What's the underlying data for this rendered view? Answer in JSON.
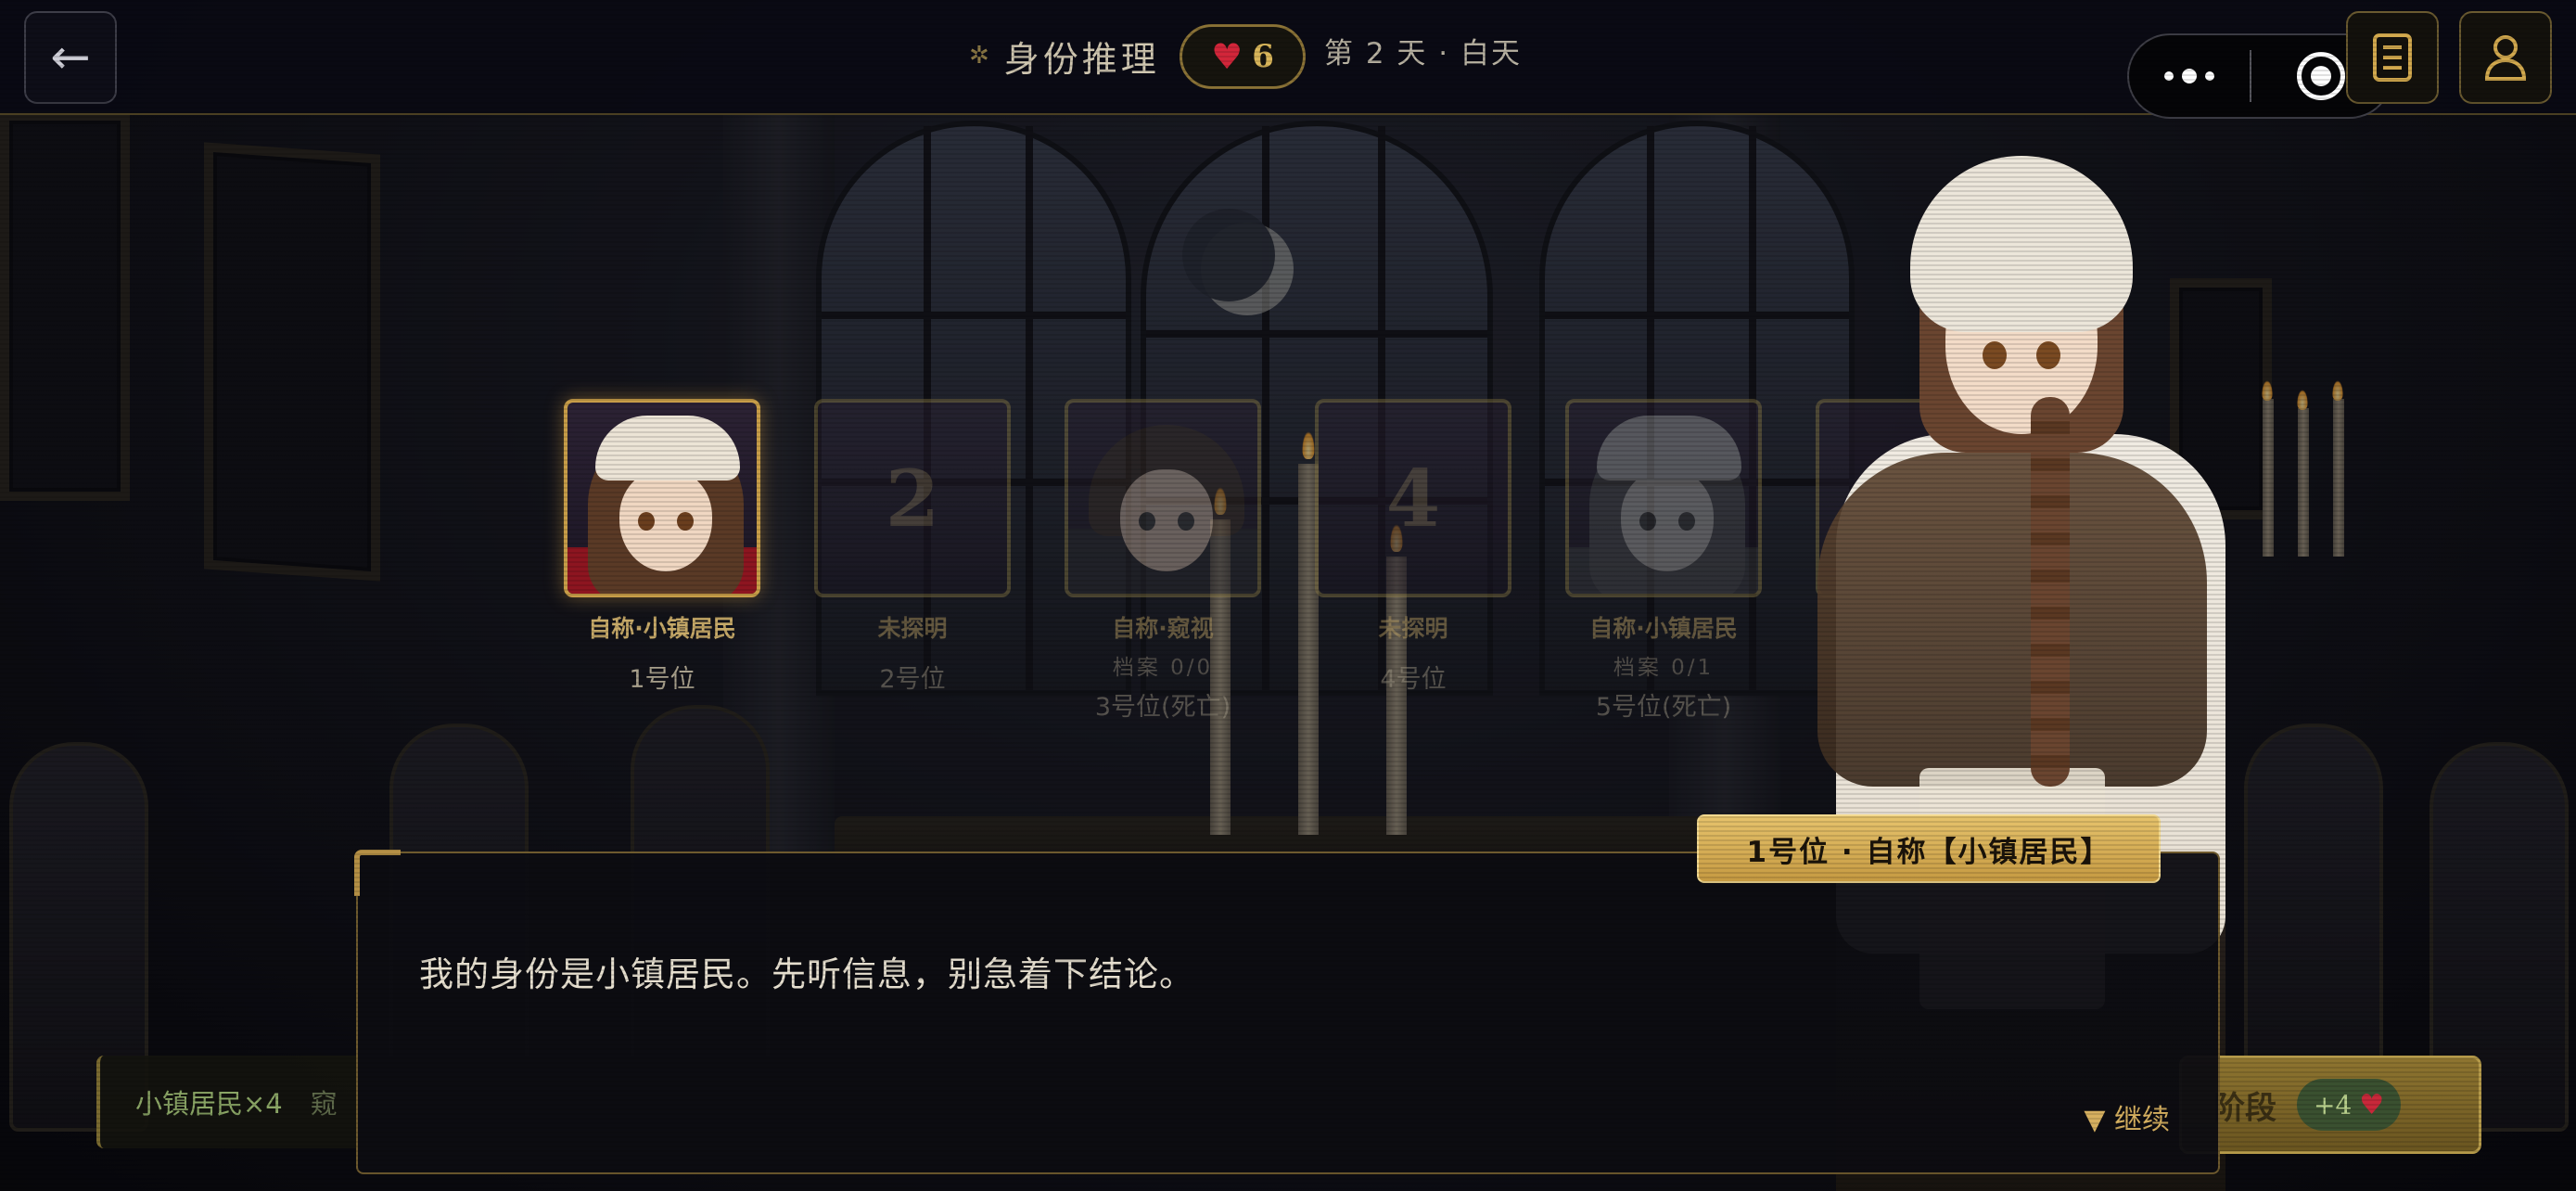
{
  "header": {
    "title": "身份推理",
    "title_icon": "compass-icon",
    "lives": "6",
    "day_label": "第 2 天 · 白天",
    "back_icon": "←"
  },
  "slots": [
    {
      "number": "",
      "name": "自称·小镇居民",
      "archive": "",
      "position": "1号位",
      "state": "active"
    },
    {
      "number": "2",
      "name": "未探明",
      "archive": "",
      "position": "2号位",
      "state": "faded"
    },
    {
      "number": "",
      "name": "自称·窥视",
      "archive": "档案 0/0",
      "position": "3号位(死亡)",
      "state": "faded"
    },
    {
      "number": "4",
      "name": "未探明",
      "archive": "",
      "position": "4号位",
      "state": "faded"
    },
    {
      "number": "",
      "name": "自称·小镇居民",
      "archive": "档案 0/1",
      "position": "5号位(死亡)",
      "state": "faded"
    }
  ],
  "dialogue": {
    "speaker": "1号位 · 自称【小镇居民】",
    "text": "我的身份是小镇居民。先听信息，别急着下结论。",
    "continue_label": "▼ 继续"
  },
  "role_bar": {
    "item1": "小镇居民×4",
    "item2": "窥"
  },
  "phase_button": {
    "label": "阶段",
    "bonus": "+4"
  },
  "colors": {
    "accent_gold": "#c79d48",
    "heart_red": "#d2263a",
    "background": "#0b0b12"
  }
}
